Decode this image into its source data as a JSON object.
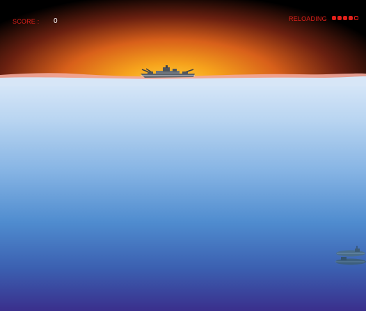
{
  "hud": {
    "score_label": "SCORE :",
    "score_value": "0",
    "reload_label": "RELOADING",
    "reload_slots": [
      true,
      true,
      true,
      true,
      false
    ]
  },
  "colors": {
    "hud_red": "#e0201a",
    "hud_white": "#ffffff",
    "sun_core": "#ffd33a",
    "sky_glow": "#d8601a",
    "sea_top": "#dbe9f9",
    "sea_bottom": "#3a2f8c",
    "ship_gray": "#5a5f66"
  },
  "icons": {
    "player_ship": "battleship-icon",
    "enemy": "submarine-icon",
    "ammo": "ammo-dot-icon"
  }
}
